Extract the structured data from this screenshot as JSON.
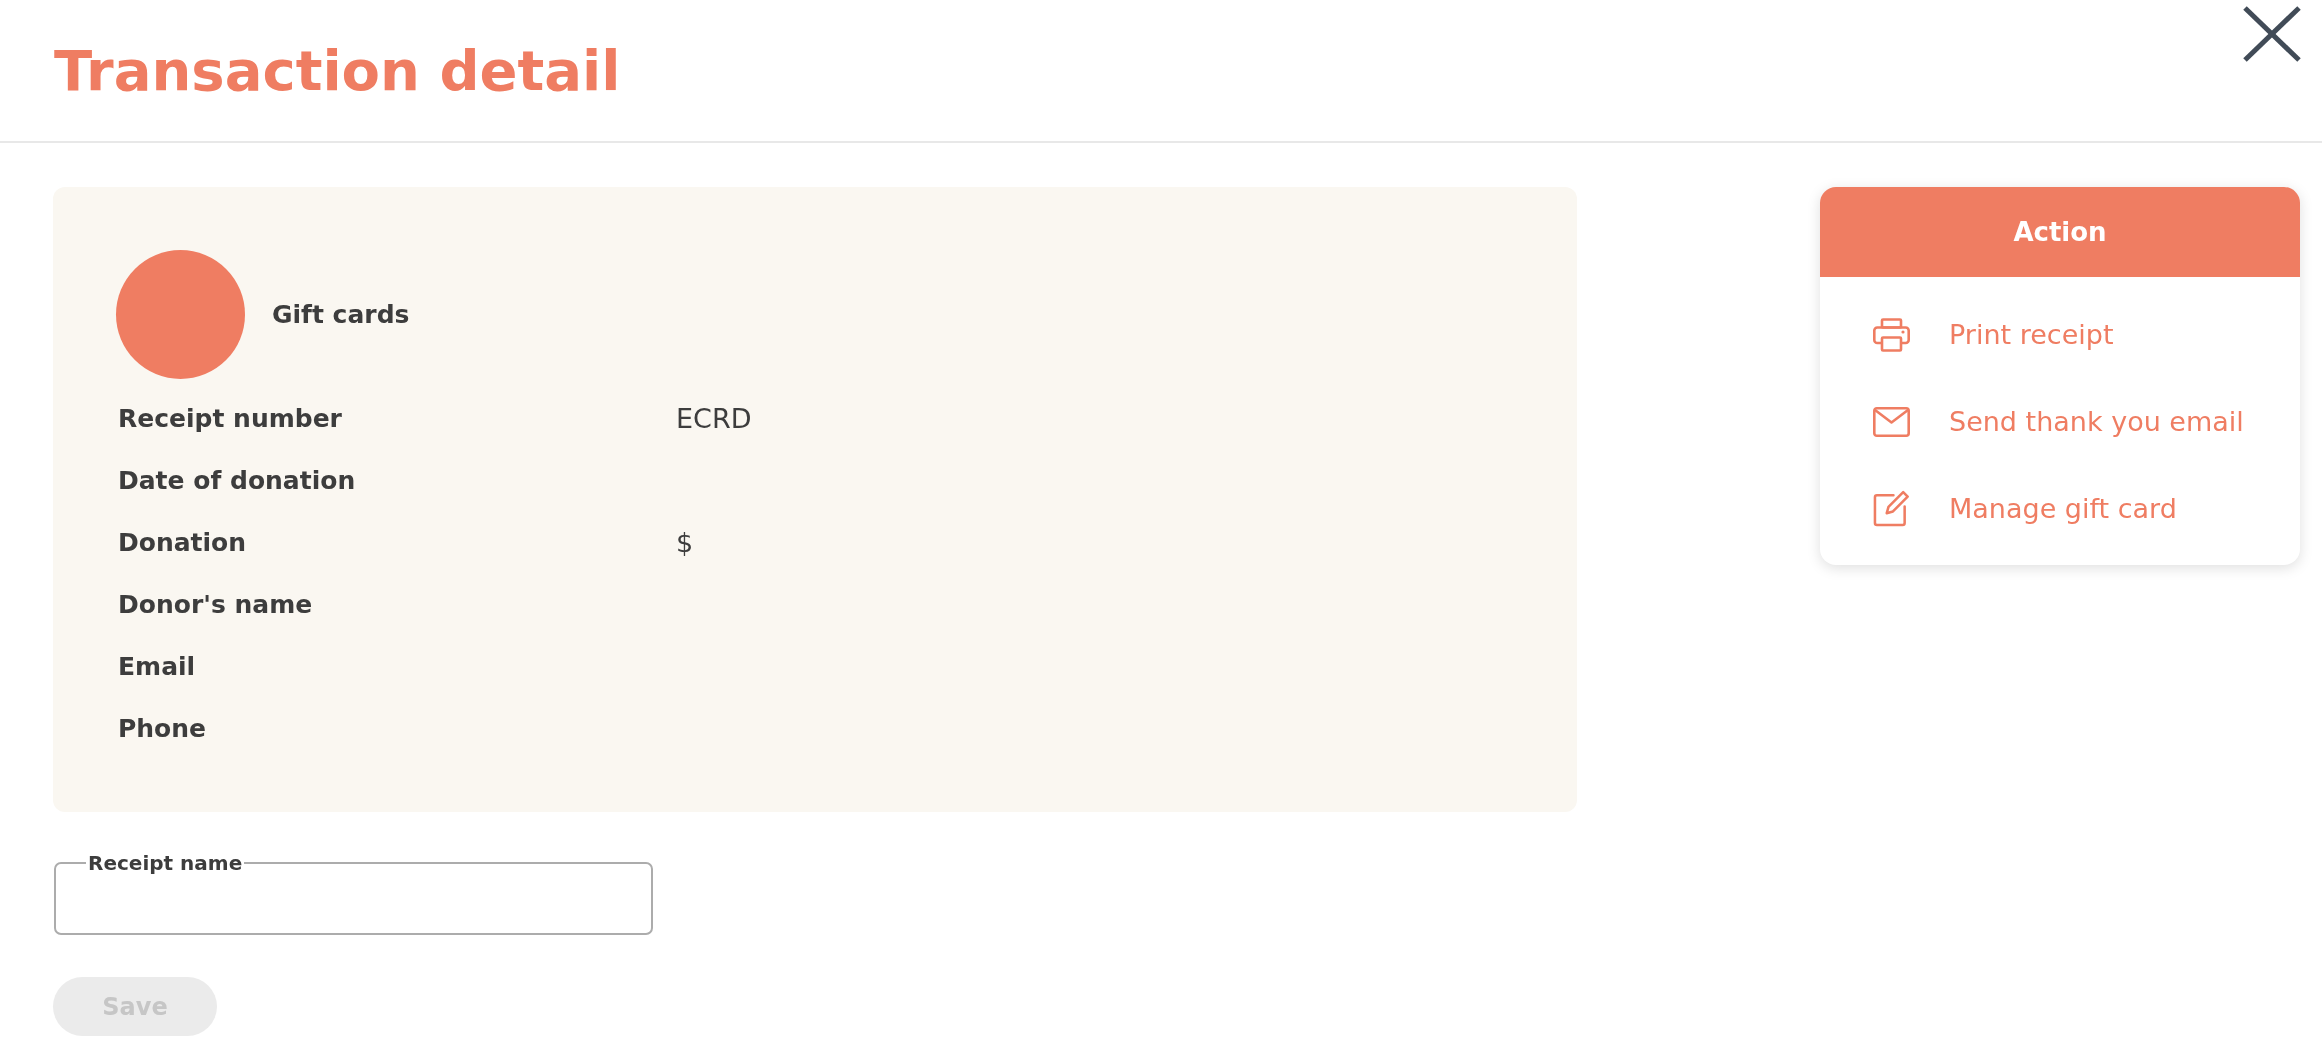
{
  "header": {
    "title": "Transaction detail"
  },
  "summary": {
    "category": "Gift cards",
    "rows": [
      {
        "label": "Receipt number",
        "value": "ECRD"
      },
      {
        "label": "Date of donation"
      },
      {
        "label": "Donation",
        "value": "$"
      },
      {
        "label": "Donor's name"
      },
      {
        "label": "Email"
      },
      {
        "label": "Phone"
      }
    ]
  },
  "receipt_name_field": {
    "label": "Receipt name"
  },
  "save_button": {
    "label": "Save",
    "disabled": true
  },
  "action_panel": {
    "title": "Action",
    "items": [
      {
        "kind": "print",
        "label": "Print receipt"
      },
      {
        "kind": "email",
        "label": "Send thank you email"
      },
      {
        "kind": "edit",
        "label": "Manage gift card"
      }
    ]
  }
}
